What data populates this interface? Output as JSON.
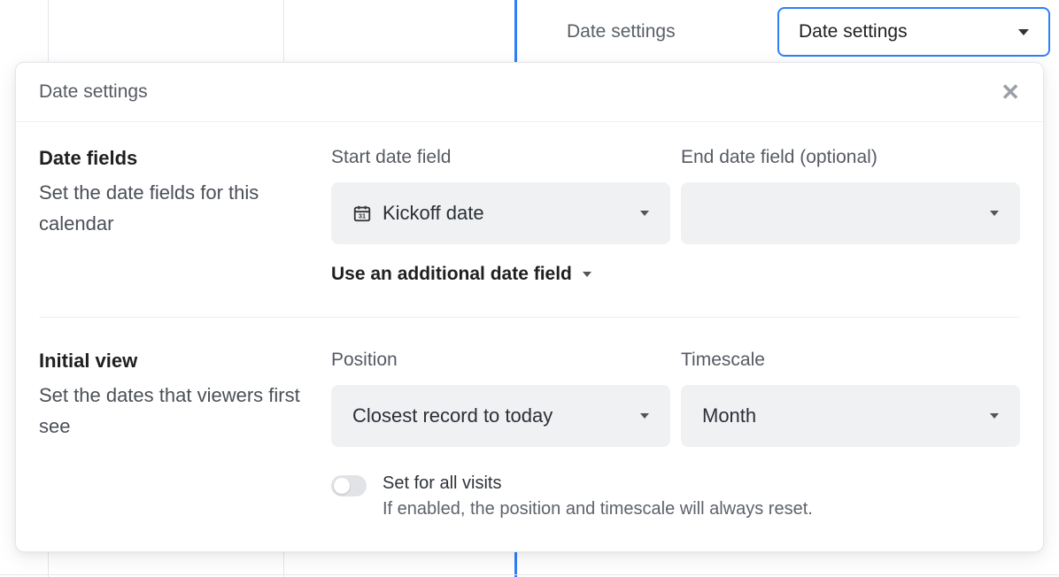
{
  "header": {
    "label": "Date settings",
    "dropdown_value": "Date settings"
  },
  "modal": {
    "title": "Date settings",
    "sections": {
      "date_fields": {
        "title": "Date fields",
        "description": "Set the date fields for this calendar",
        "start_label": "Start date field",
        "start_value": "Kickoff date",
        "end_label": "End date field (optional)",
        "end_value": "",
        "additional_label": "Use an additional date field"
      },
      "initial_view": {
        "title": "Initial view",
        "description": "Set the dates that viewers first see",
        "position_label": "Position",
        "position_value": "Closest record to today",
        "timescale_label": "Timescale",
        "timescale_value": "Month",
        "toggle": {
          "enabled": false,
          "title": "Set for all visits",
          "description": "If enabled, the position and timescale will always reset."
        }
      }
    }
  },
  "colors": {
    "accent": "#2d7ff9"
  }
}
